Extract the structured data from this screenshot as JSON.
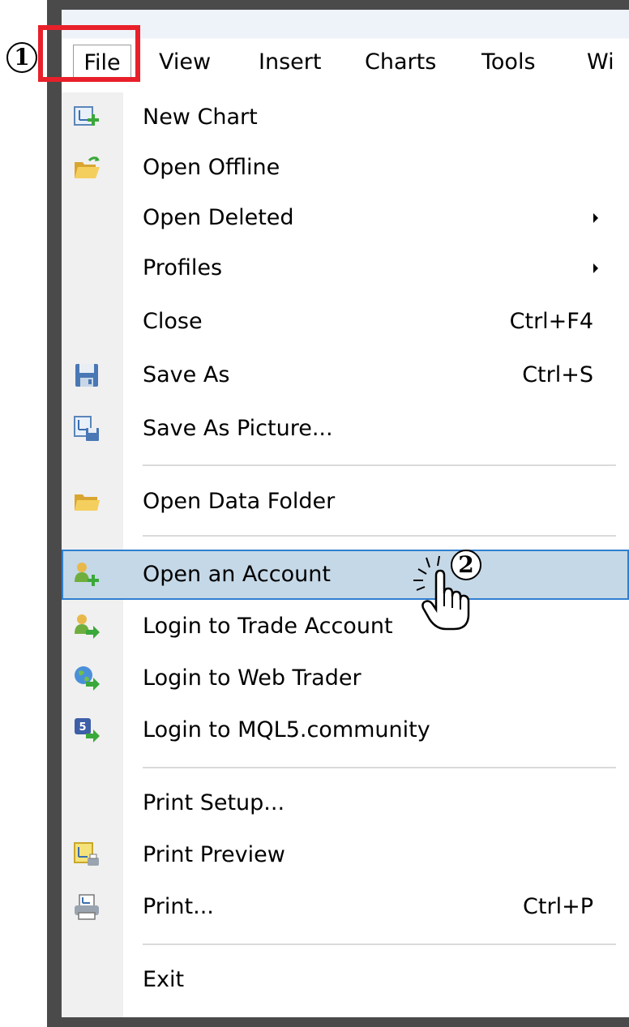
{
  "menubar": {
    "items": [
      {
        "label": "File"
      },
      {
        "label": "View"
      },
      {
        "label": "Insert"
      },
      {
        "label": "Charts"
      },
      {
        "label": "Tools"
      },
      {
        "label": "Wi"
      }
    ]
  },
  "annotations": {
    "badge_1": "1",
    "badge_2": "2",
    "highlight_color": "#e8202a"
  },
  "file_menu": {
    "items": [
      {
        "label": "New Chart",
        "icon": "new-chart-icon"
      },
      {
        "label": "Open Offline",
        "icon": "open-folder-icon"
      },
      {
        "label": "Open Deleted",
        "submenu": true
      },
      {
        "label": "Profiles",
        "submenu": true
      },
      {
        "label": "Close",
        "shortcut": "Ctrl+F4"
      },
      {
        "label": "Save As",
        "shortcut": "Ctrl+S",
        "icon": "floppy-disk-icon"
      },
      {
        "label": "Save As Picture...",
        "icon": "save-picture-icon"
      },
      {
        "label": "Open Data Folder",
        "icon": "folder-icon"
      },
      {
        "label": "Open an Account",
        "icon": "user-add-icon",
        "highlighted": true
      },
      {
        "label": "Login to Trade Account",
        "icon": "user-login-icon"
      },
      {
        "label": "Login to Web Trader",
        "icon": "globe-login-icon"
      },
      {
        "label": "Login to MQL5.community",
        "icon": "mql5-login-icon"
      },
      {
        "label": "Print Setup..."
      },
      {
        "label": "Print Preview",
        "icon": "print-preview-icon"
      },
      {
        "label": "Print...",
        "shortcut": "Ctrl+P",
        "icon": "printer-icon"
      },
      {
        "label": "Exit"
      }
    ]
  },
  "colors": {
    "hover_bg": "#c5d8e7",
    "hover_border": "#2f7fd0"
  }
}
